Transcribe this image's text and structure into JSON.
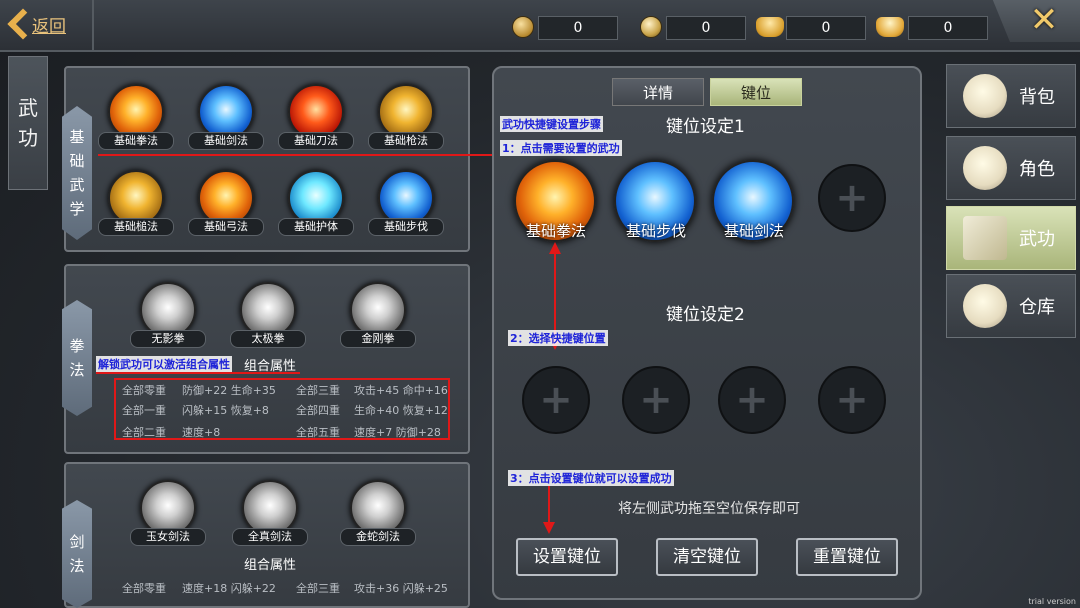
{
  "topbar": {
    "back_label": "返回",
    "currencies": [
      "0",
      "0",
      "0",
      "0"
    ]
  },
  "left_tab": {
    "label_1": "武",
    "label_2": "功"
  },
  "basic": {
    "side_label": [
      "基",
      "础",
      "武",
      "学"
    ],
    "skills": [
      "基础拳法",
      "基础剑法",
      "基础刀法",
      "基础枪法",
      "基础槌法",
      "基础弓法",
      "基础护体",
      "基础步伐"
    ]
  },
  "fist": {
    "side_label": [
      "拳",
      "法"
    ],
    "skills": [
      "无影拳",
      "太极拳",
      "金刚拳"
    ],
    "combo_title": "组合属性",
    "attrs": [
      [
        "全部零重",
        "防御+22 生命+35",
        "全部三重",
        "攻击+45 命中+16"
      ],
      [
        "全部一重",
        "闪躲+15 恢复+8",
        "全部四重",
        "生命+40 恢复+12"
      ],
      [
        "全部二重",
        "速度+8",
        "全部五重",
        "速度+7 防御+28"
      ]
    ]
  },
  "sword": {
    "side_label": [
      "剑",
      "法"
    ],
    "skills": [
      "玉女剑法",
      "全真剑法",
      "金蛇剑法"
    ],
    "combo_title": "组合属性",
    "attrs": [
      [
        "全部零重",
        "速度+18 闪躲+22",
        "全部三重",
        "攻击+36 闪躲+25"
      ]
    ]
  },
  "annotations": {
    "unlock_note": "解锁武功可以激活组合属性",
    "steps_title": "武功快捷键设置步骤",
    "step1": "1：点击需要设置的武功",
    "step2": "2：选择快捷键位置",
    "step3": "3：点击设置键位就可以设置成功"
  },
  "keybind": {
    "tabs": [
      "详情",
      "键位"
    ],
    "set1_title": "键位设定1",
    "set1_slots": [
      "基础拳法",
      "基础步伐",
      "基础剑法"
    ],
    "set2_title": "键位设定2",
    "hint": "将左侧武功拖至空位保存即可",
    "buttons": [
      "设置键位",
      "清空键位",
      "重置键位"
    ]
  },
  "right_nav": [
    "背包",
    "角色",
    "武功",
    "仓库"
  ],
  "colors": {
    "accent_gold": "#e8b04c",
    "annotation_red": "#e01818",
    "annotation_blue": "#1f24d8",
    "active_tab": "#c5cf98"
  },
  "watermark": "trial version"
}
